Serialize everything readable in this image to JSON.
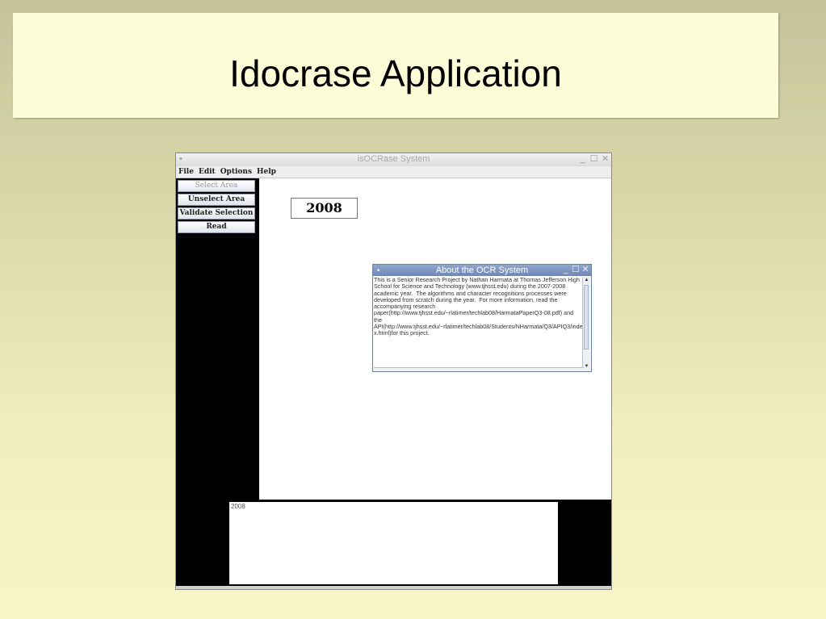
{
  "slide": {
    "title": "Idocrase Application"
  },
  "window": {
    "title": "isOCRase System",
    "controls": {
      "minimize": "_",
      "maximize": "☐",
      "close": "✕"
    }
  },
  "menu": [
    "File",
    "Edit",
    "Options",
    "Help"
  ],
  "sidebar": {
    "buttons": [
      {
        "label": "Select Area",
        "enabled": false
      },
      {
        "label": "Unselect Area",
        "enabled": true
      },
      {
        "label": "Validate Selection",
        "enabled": true
      },
      {
        "label": "Read",
        "enabled": true
      }
    ]
  },
  "canvas": {
    "selected_text": "2008"
  },
  "about_dialog": {
    "title": "About the OCR System",
    "body": "This is a Senior Research Project by Nathan Harmata at Thomas Jefferson High School for Science and Technology (www.tjhsst.edu) during the 2007-2008 academic year.  The algorithms and character recognitions processes were developed from scratch during the year.  For more information, read the accompanying research paper(http://www.tjhsst.edu/~rlatimer/techlab08/HarmataPaperQ3-08.pdf) and the API(http://www.tjhsst.edu/~rlatimer/techlab08/Students/NHarmata/Q3/APIQ3/index.html)for this project."
  },
  "output": {
    "text": "2008"
  },
  "colors": {
    "slide_title_bg": "#fdfdd8",
    "dialog_title_bg": "#7b93bd",
    "sidebar_bg": "#000000"
  }
}
